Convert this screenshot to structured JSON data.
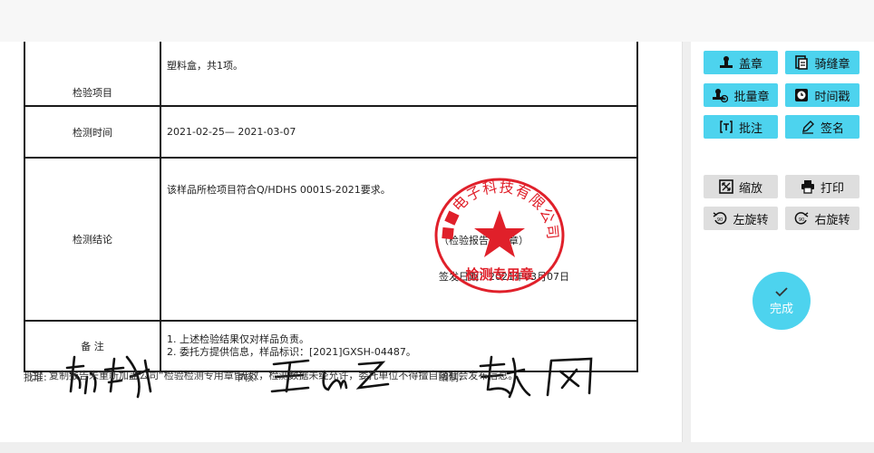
{
  "report": {
    "rows": [
      {
        "label": "检验项目",
        "value": "塑料盒，共1项。"
      },
      {
        "label": "检测时间",
        "value": "2021-02-25— 2021-03-07"
      },
      {
        "label": "检测结论",
        "value": "该样品所检项目符合Q/HDHS 0001S-2021要求。",
        "sub1": "（检验报告专用章）",
        "sub2": "签发日期：2021年03月07日"
      },
      {
        "label": "备 注",
        "line1": "1. 上述检验结果仅对样品负责。",
        "line2": "2. 委托方提供信息，样品标识：[2021]GXSH-04487。"
      }
    ],
    "seal": {
      "ring_text": "■■电子科技有限公司",
      "center_text": "检测专用章",
      "color": "#e0202a"
    },
    "signatures": {
      "approve_label": "批准:",
      "review_label": "审核:",
      "edit_label": "编制:"
    },
    "note_text": "注：复制报告未重新加盖公司“检验检测专用章”无效，检测数据未经允许，委托单位不得擅自向社会发布信息。"
  },
  "toolbar": {
    "stamp": "盖章",
    "seam": "骑缝章",
    "batch": "批量章",
    "timestamp": "时间戳",
    "annotate": "批注",
    "sign": "签名",
    "zoom": "缩放",
    "print": "打印",
    "rotate_left": "左旋转",
    "rotate_right": "右旋转",
    "done": "完成"
  },
  "colors": {
    "accent": "#4dd3ee",
    "gray_button": "#dedede",
    "seal_red": "#e0202a"
  }
}
